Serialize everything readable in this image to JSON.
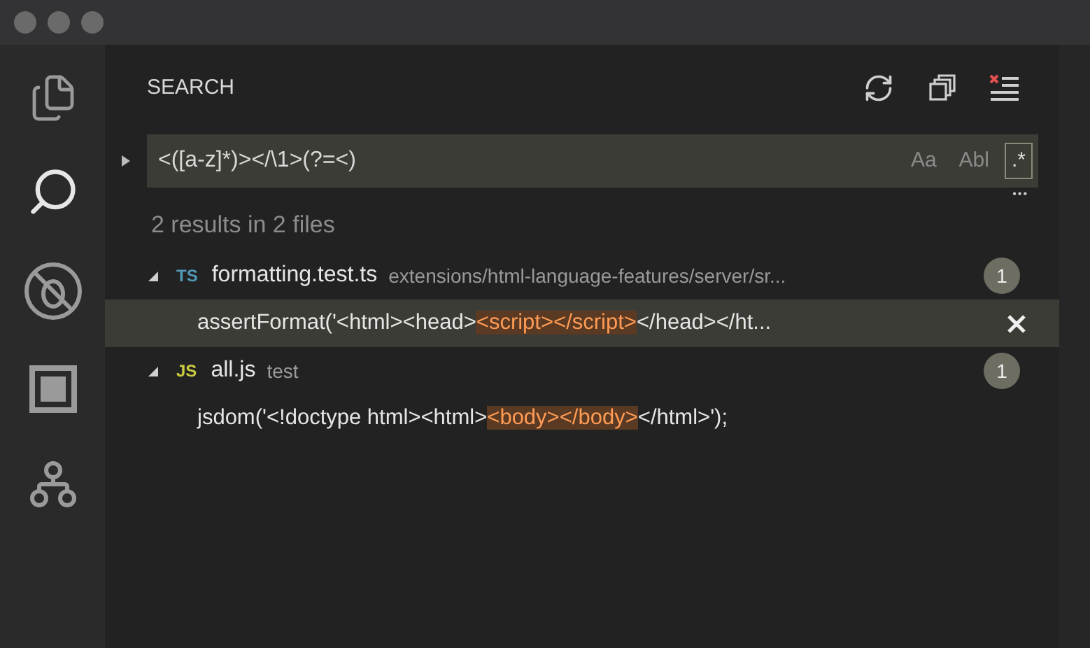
{
  "panel": {
    "title": "SEARCH"
  },
  "search": {
    "value": "<([a-z]*)></\\1>(?=<)",
    "replace_expanded": false,
    "toggles": [
      {
        "label": "Aa",
        "on": false
      },
      {
        "label": "Abl",
        "on": false
      },
      {
        "label": ".*",
        "on": true
      }
    ]
  },
  "more": "•••",
  "summary": "2 results in 2 files",
  "files": [
    {
      "badge": "TS",
      "color": "#519aba",
      "name": "formatting.test.ts",
      "path": "extensions/html-language-features/server/sr...",
      "count": "1",
      "expanded": true,
      "matches": [
        {
          "before": "assertFormat('<html><head>",
          "match": "<script></script>",
          "after": "</head></ht...",
          "selected": true
        }
      ]
    },
    {
      "badge": "JS",
      "color": "#cbcb41",
      "name": "all.js",
      "path": "test",
      "count": "1",
      "expanded": true,
      "matches": [
        {
          "before": "jsdom('<!doctype html><html>",
          "match": "<body></body>",
          "after": "</html>');",
          "selected": false
        }
      ]
    }
  ]
}
